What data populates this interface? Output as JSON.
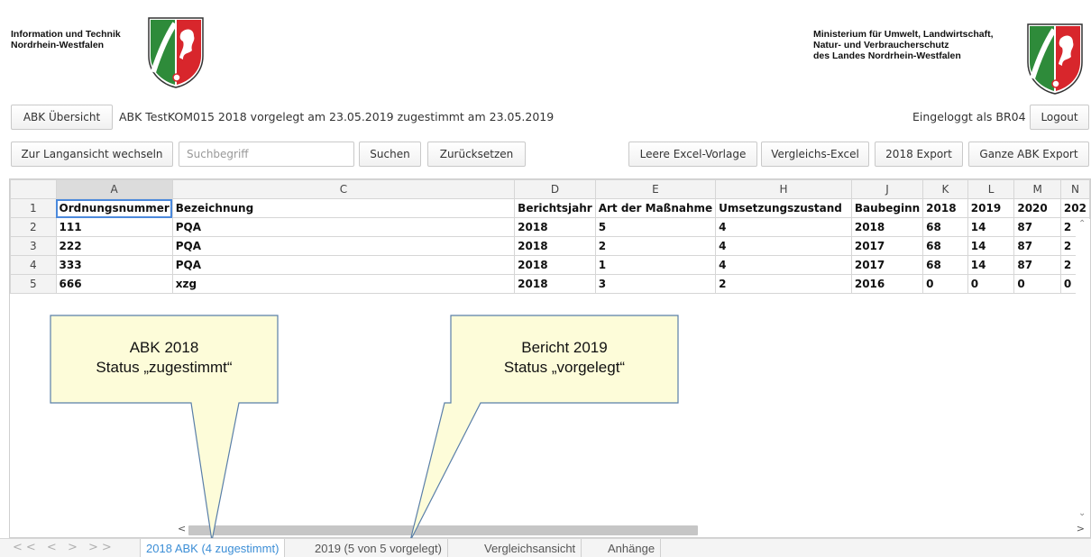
{
  "header": {
    "org_left_line1": "Information und Technik",
    "org_left_line2": "Nordrhein-Westfalen",
    "org_right_line1": "Ministerium für Umwelt, Landwirtschaft,",
    "org_right_line2": "Natur- und Verbraucherschutz",
    "org_right_line3": "des Landes Nordrhein-Westfalen",
    "crest_icon": "nrw-crest-icon"
  },
  "toolbar1": {
    "overview_button": "ABK Übersicht",
    "status_text": "ABK TestKOM015 2018 vorgelegt am 23.05.2019 zugestimmt am 23.05.2019",
    "login_text": "Eingeloggt als BR04",
    "logout_button": "Logout"
  },
  "toolbar2": {
    "long_view_button": "Zur Langansicht wechseln",
    "search_placeholder": "Suchbegriff",
    "search_button": "Suchen",
    "reset_button": "Zurücksetzen",
    "empty_excel_button": "Leere Excel-Vorlage",
    "compare_excel_button": "Vergleichs-Excel",
    "export_2018_button": "2018 Export",
    "full_export_button": "Ganze ABK Export"
  },
  "sheet": {
    "column_letters": [
      "A",
      "C",
      "D",
      "E",
      "H",
      "J",
      "K",
      "L",
      "M",
      "N"
    ],
    "row_numbers": [
      "1",
      "2",
      "3",
      "4",
      "5"
    ],
    "header_row": [
      "Ordnungsnummer",
      "Bezeichnung",
      "Berichtsjahr",
      "Art der Maßnahme",
      "Umsetzungszustand",
      "Baubeginn",
      "2018",
      "2019",
      "2020",
      "202"
    ],
    "rows": [
      [
        "111",
        "PQA",
        "2018",
        "5",
        "4",
        "2018",
        "68",
        "14",
        "87",
        "2"
      ],
      [
        "222",
        "PQA",
        "2018",
        "2",
        "4",
        "2017",
        "68",
        "14",
        "87",
        "2"
      ],
      [
        "333",
        "PQA",
        "2018",
        "1",
        "4",
        "2017",
        "68",
        "14",
        "87",
        "2"
      ],
      [
        "666",
        "xzg",
        "2018",
        "3",
        "2",
        "2016",
        "0",
        "0",
        "0",
        "0"
      ]
    ]
  },
  "callouts": {
    "left_line1": "ABK 2018",
    "left_line2": "Status „zugestimmt“",
    "right_line1": "Bericht 2019",
    "right_line2": "Status „vorgelegt“",
    "fill_color": "#fdfcd9"
  },
  "tabs": {
    "nav_arrows": "<< < > >>",
    "items": [
      "2018 ABK (4 zugestimmt)",
      "2019 (5 von 5 vorgelegt)",
      "Vergleichsansicht",
      "Anhänge"
    ],
    "active_color": "#3c8ed6"
  }
}
